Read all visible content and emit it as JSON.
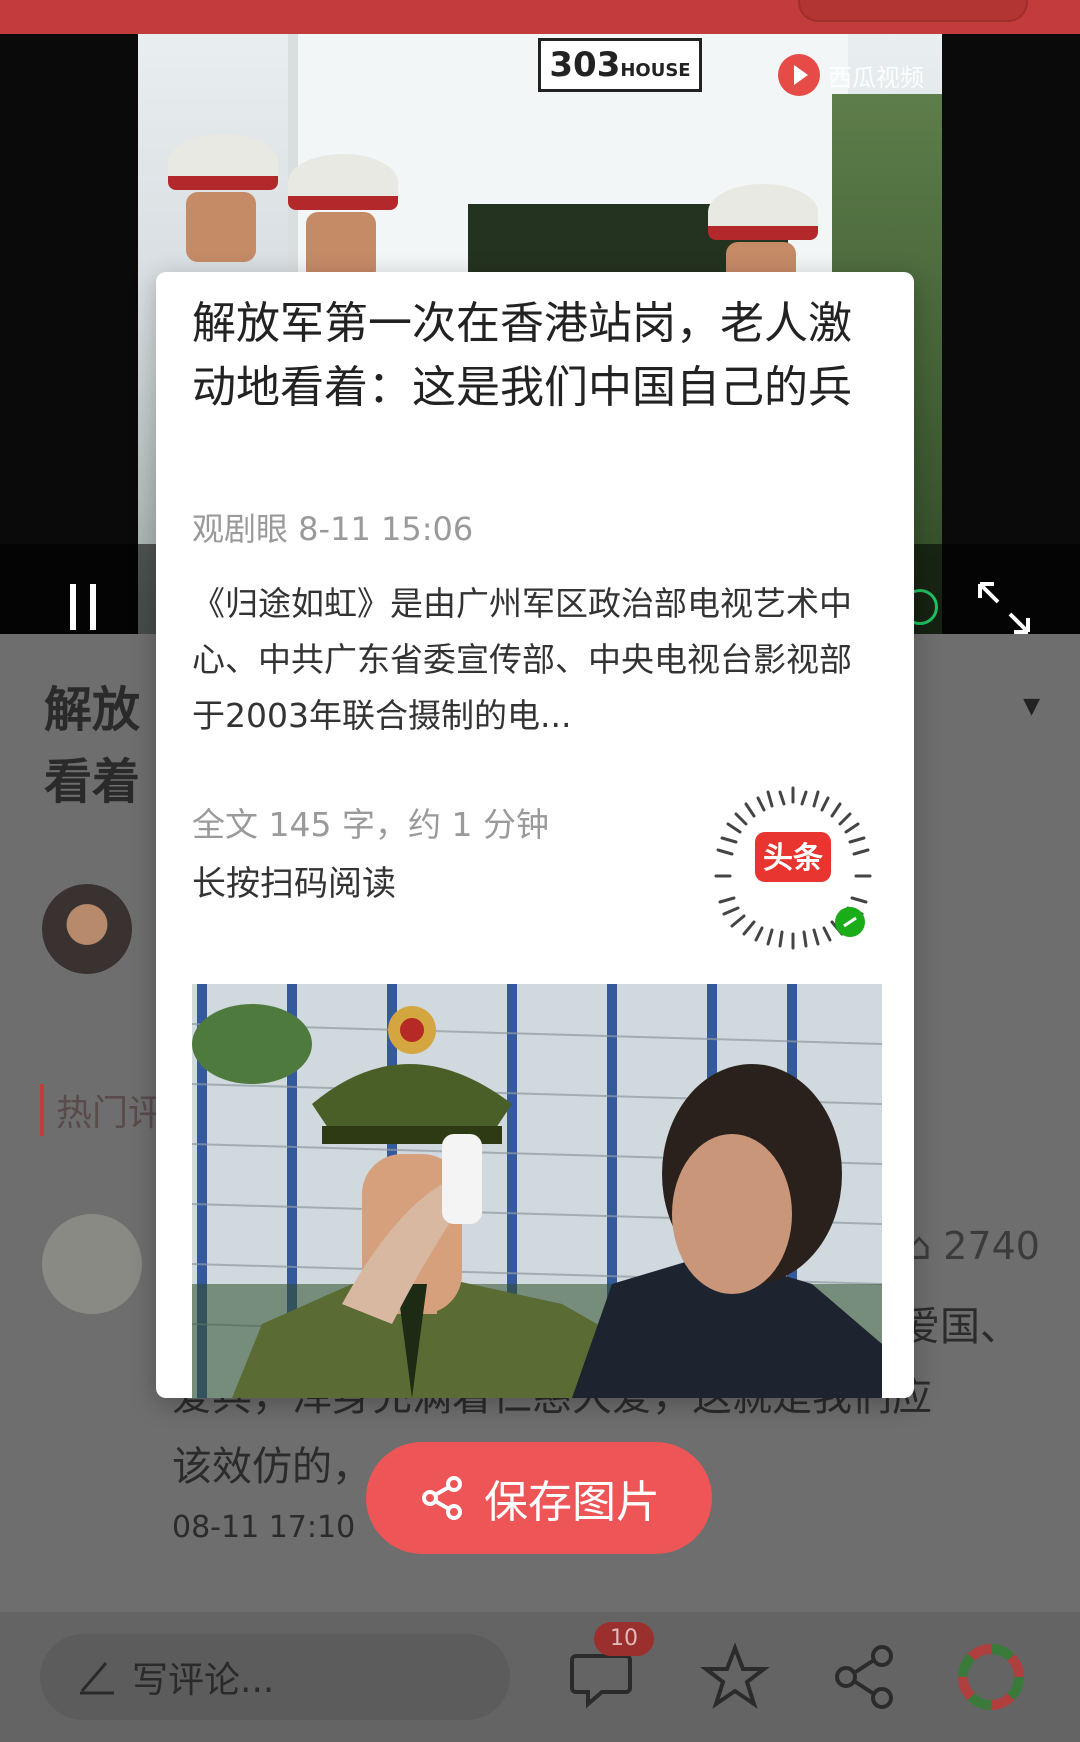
{
  "video": {
    "sign_number": "303",
    "sign_suffix": "HOUSE",
    "watermark": "西瓜视频"
  },
  "card": {
    "title": "解放军第一次在香港站岗，老人激动地看着：这是我们中国自己的兵",
    "meta": "观剧眼 8-11 15:06",
    "summary": "《归途如虹》是由广州军区政治部电视艺术中心、中共广东省委宣传部、中央电视台影视部于2003年联合摄制的电...",
    "word_count": "全文 145 字，约 1 分钟",
    "scan_hint": "长按扫码阅读",
    "qr_label": "头条"
  },
  "save_button": {
    "label": "保存图片"
  },
  "background": {
    "title_fragment_1": "解放",
    "title_fragment_2": "看着",
    "hot_comments": "热门评",
    "likes": "2740",
    "comment_line_1": "爱国、",
    "comment_line_2": "爱兵，浑身充满着仁慈大爱，这就是我们应",
    "comment_line_3": "该效仿的，",
    "comment_time": "08-11 17:10"
  },
  "bottom_bar": {
    "comment_placeholder": "写评论...",
    "comment_count": "10"
  },
  "colors": {
    "accent": "#ee5556",
    "top_bar": "#c23c3b",
    "overlay_bg": "#6b6b6b"
  },
  "icons": [
    "pause-icon",
    "fullscreen-icon",
    "share-icon",
    "star-icon",
    "comment-icon",
    "pen-icon",
    "camera-icon"
  ]
}
